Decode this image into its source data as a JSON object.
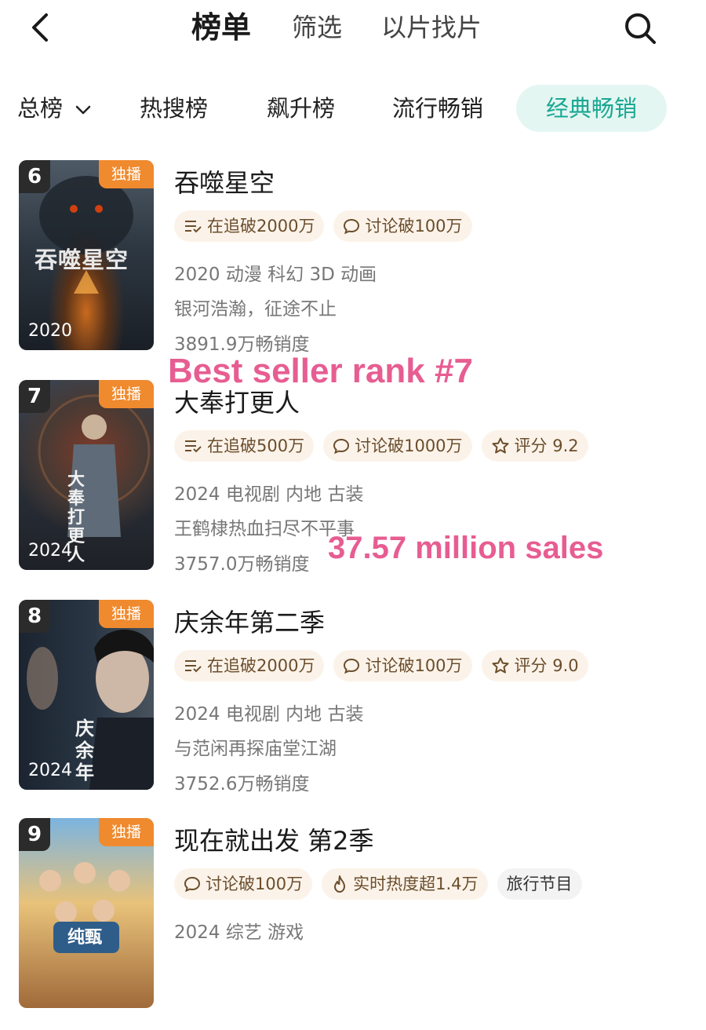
{
  "topnav": {
    "tabs": [
      "榜单",
      "筛选",
      "以片找片"
    ]
  },
  "categories": [
    "总榜",
    "热搜榜",
    "飙升榜",
    "流行畅销",
    "经典畅销"
  ],
  "items": [
    {
      "rank": "6",
      "badge": "独播",
      "year": "2020",
      "poster_text": "吞噬星空",
      "title": "吞噬星空",
      "tags": [
        "在追破2000万",
        "讨论破100万"
      ],
      "meta1": "2020 动漫 科幻 3D 动画",
      "meta2": "银河浩瀚，征途不止",
      "meta3": "3891.9万畅销度"
    },
    {
      "rank": "7",
      "badge": "独播",
      "year": "2024",
      "poster_text": "大奉打更人",
      "title": "大奉打更人",
      "tags": [
        "在追破500万",
        "讨论破1000万",
        "评分 9.2"
      ],
      "meta1": "2024 电视剧 内地 古装",
      "meta2": "王鹤棣热血扫尽不平事",
      "meta3": "3757.0万畅销度"
    },
    {
      "rank": "8",
      "badge": "独播",
      "year": "2024",
      "poster_text": "庆余年",
      "title": "庆余年第二季",
      "tags": [
        "在追破2000万",
        "讨论破100万",
        "评分 9.0"
      ],
      "meta1": "2024 电视剧 内地 古装",
      "meta2": "与范闲再探庙堂江湖",
      "meta3": "3752.6万畅销度"
    },
    {
      "rank": "9",
      "badge": "独播",
      "poster_text": "纯甄",
      "title": "现在就出发 第2季",
      "tags": [
        "讨论破100万",
        "实时热度超1.4万",
        "旅行节目"
      ],
      "meta1": "2024 综艺 游戏"
    }
  ],
  "annotations": {
    "best_seller": "Best seller rank #7",
    "sales": "37.57 million sales"
  },
  "colors": {
    "accent": "#1aa892",
    "accent_bg": "#e4f6f2",
    "badge_orange": "#f08a2e",
    "annotation_pink": "#e75d92",
    "tag_bg": "#fbf3e9"
  }
}
